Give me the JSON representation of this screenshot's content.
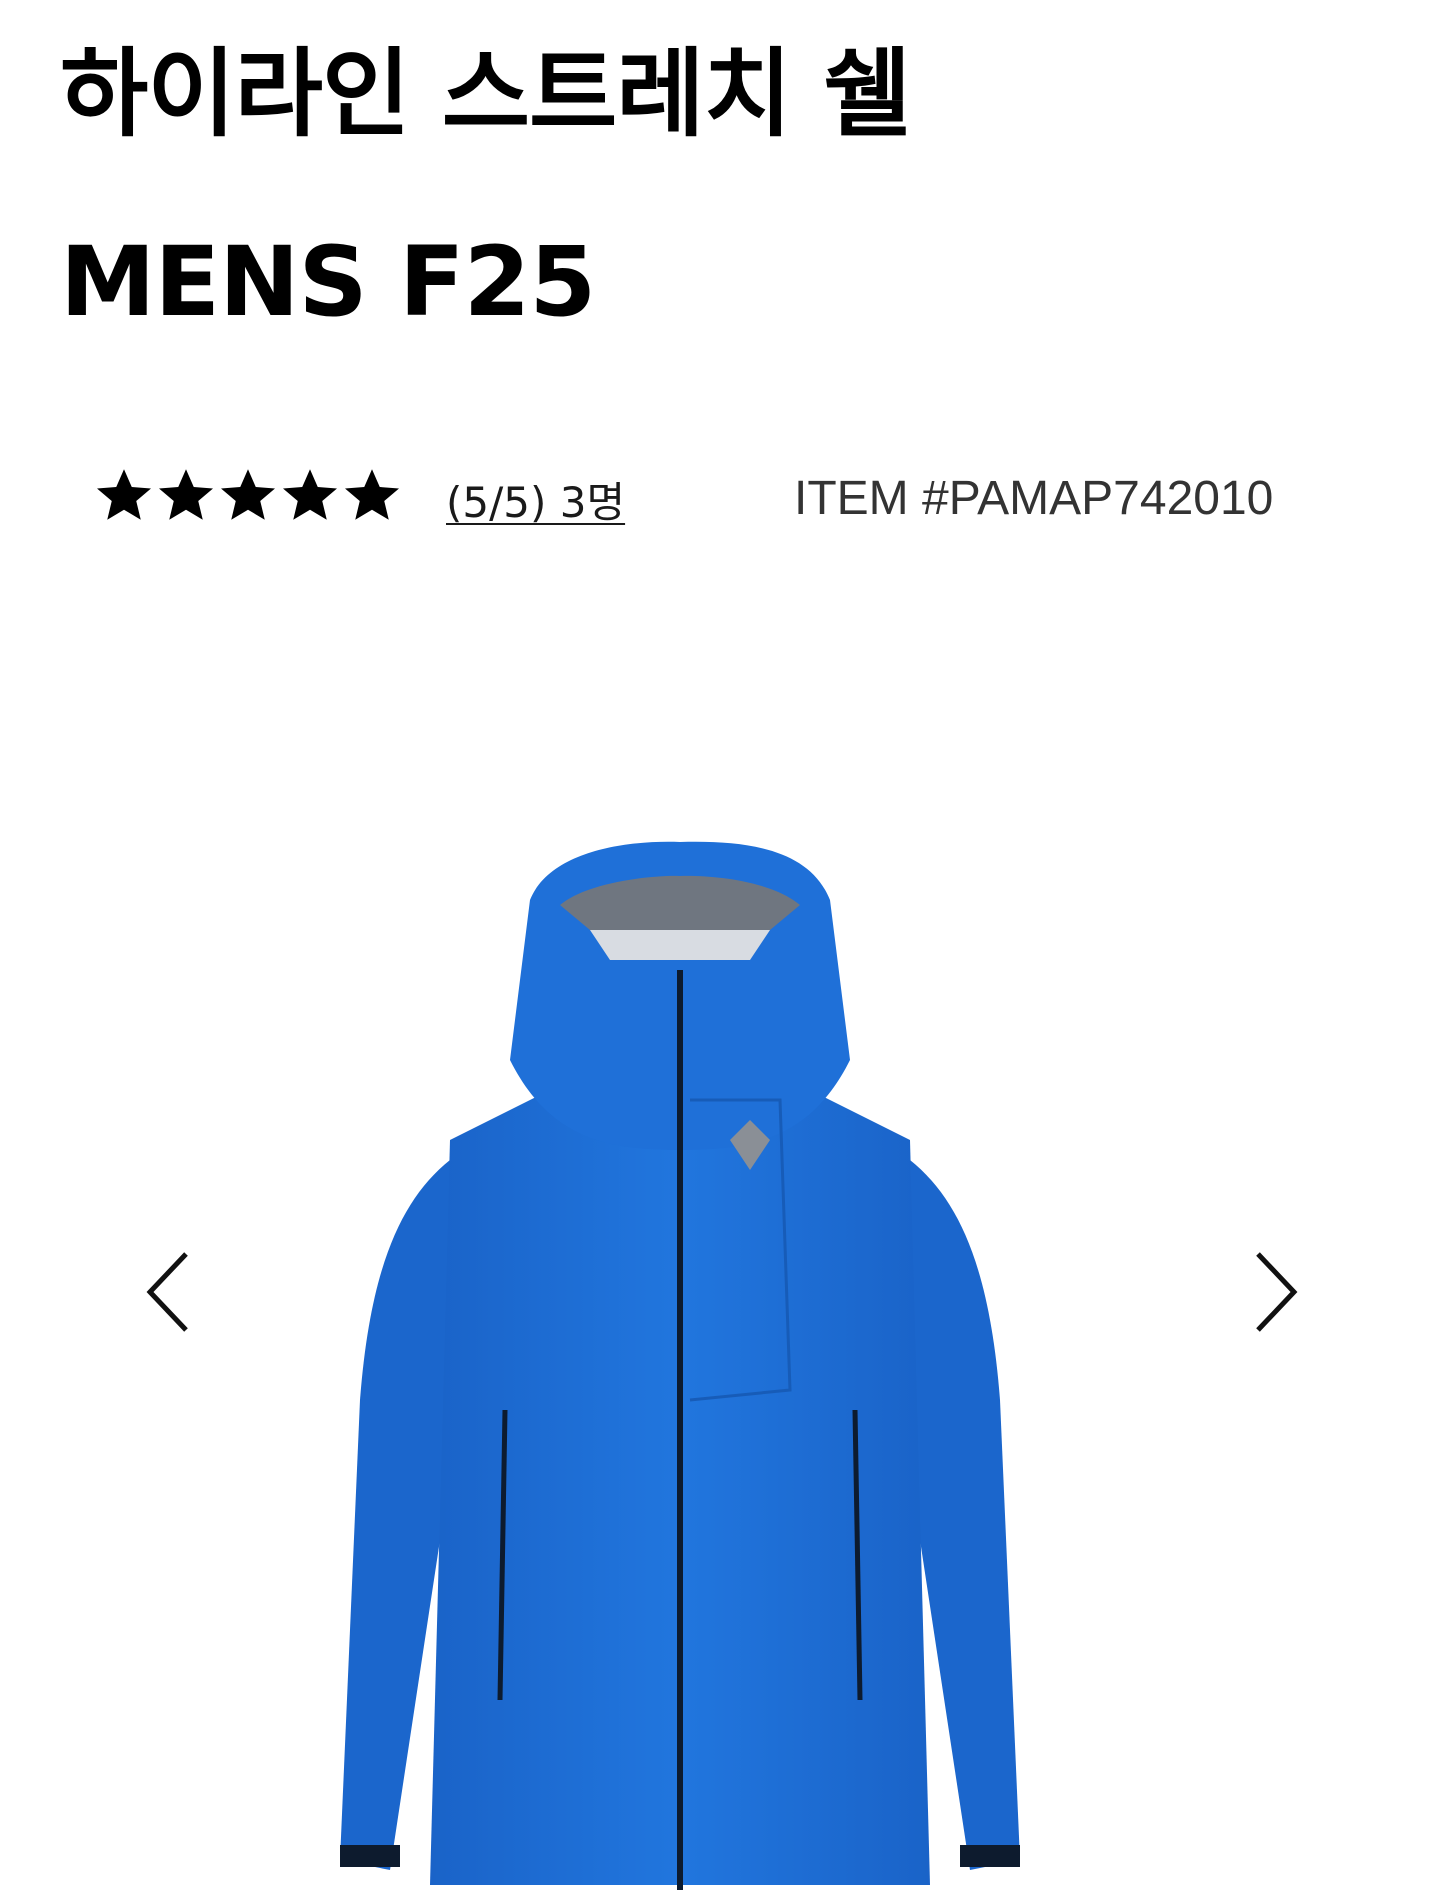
{
  "product": {
    "title_line1": "하이라인 스트레치 쉘",
    "title_line2": "MENS F25",
    "rating": {
      "value": 5,
      "max": 5,
      "link_text": "(5/5) 3명"
    },
    "item_code": "ITEM #PAMAP742010"
  },
  "gallery": {
    "image_name": "blue-hooded-shell-jacket",
    "colors": {
      "jacket": "#1e6fd6",
      "jacket_shade": "#1559b8",
      "zipper": "#0d1b2e",
      "logo": "#8a8f96"
    }
  },
  "icons": {
    "star": "star-icon",
    "prev": "chevron-left-icon",
    "next": "chevron-right-icon"
  }
}
